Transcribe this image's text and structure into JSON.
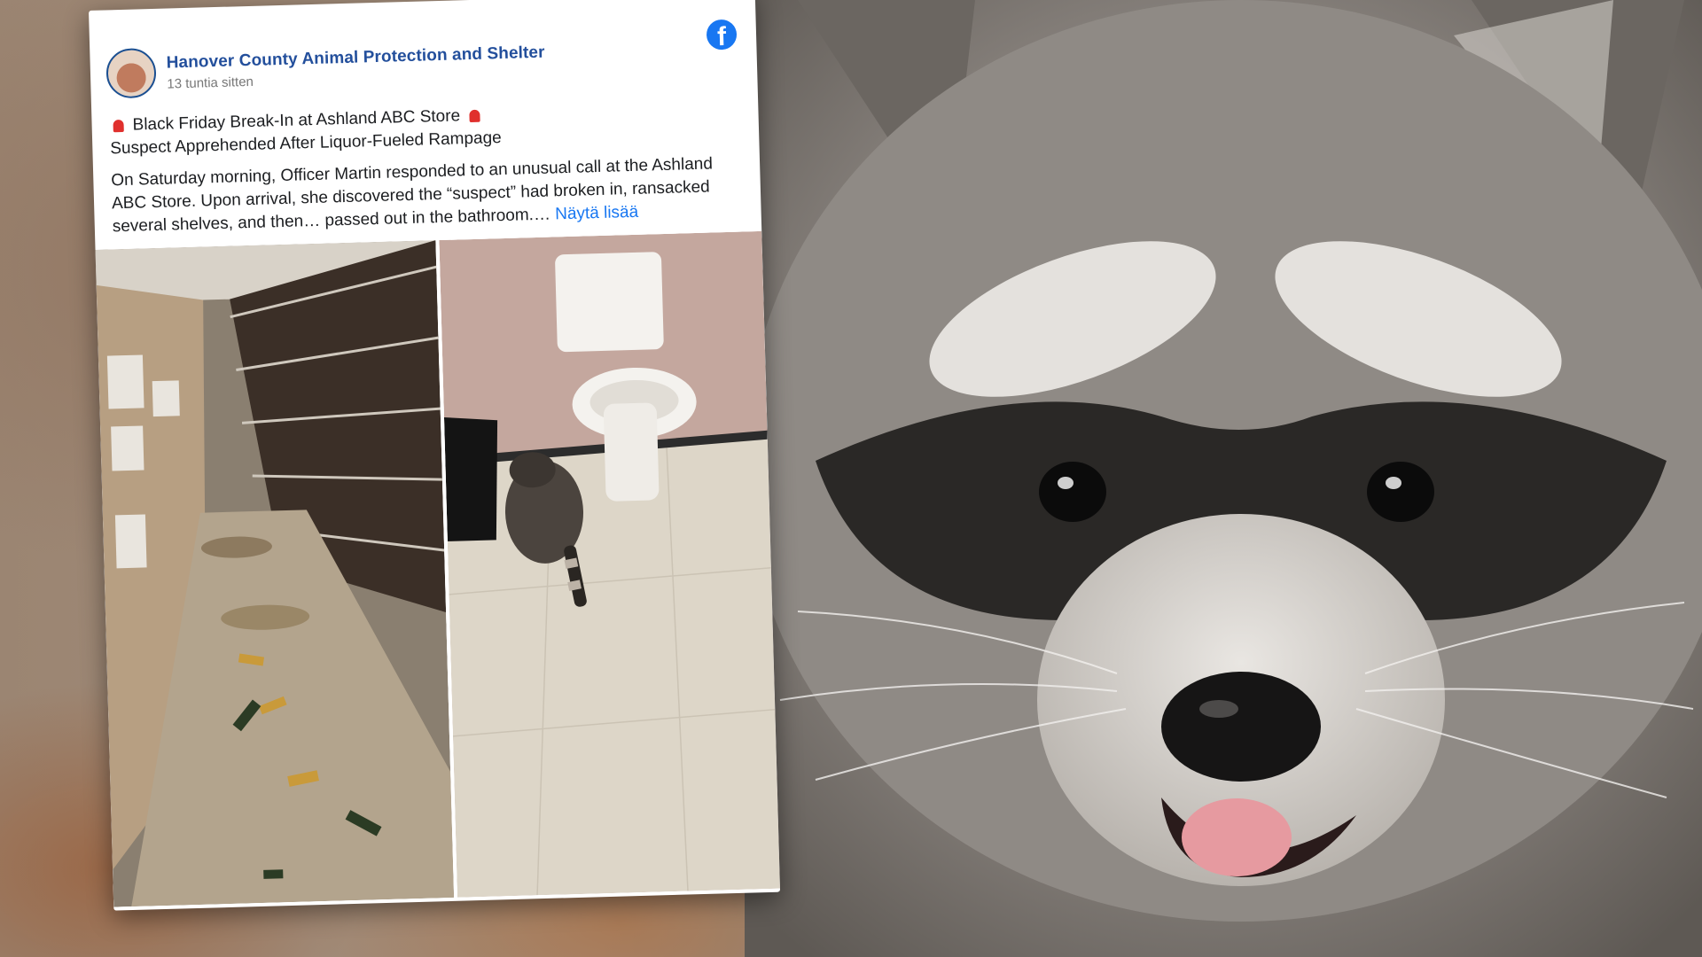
{
  "post": {
    "page_name": "Hanover County Animal Protection and Shelter",
    "timestamp": "13 tuntia sitten",
    "headline": "Black Friday Break-In at Ashland ABC Store",
    "subheadline": "Suspect Apprehended After Liquor-Fueled Rampage",
    "body": "On Saturday morning, Officer Martin responded to an unusual call at the Ashland ABC Store. Upon arrival, she discovered the “suspect” had broken in, ransacked several shelves, and then… passed out in the bathroom.…",
    "see_more": "Näytä lisää",
    "photos": [
      "liquor-aisle-photo",
      "bathroom-raccoon-photo"
    ]
  },
  "icons": [
    "facebook-logo-icon",
    "siren-icon"
  ],
  "colors": {
    "facebook_blue": "#1877f2",
    "page_name": "#234f9c"
  }
}
